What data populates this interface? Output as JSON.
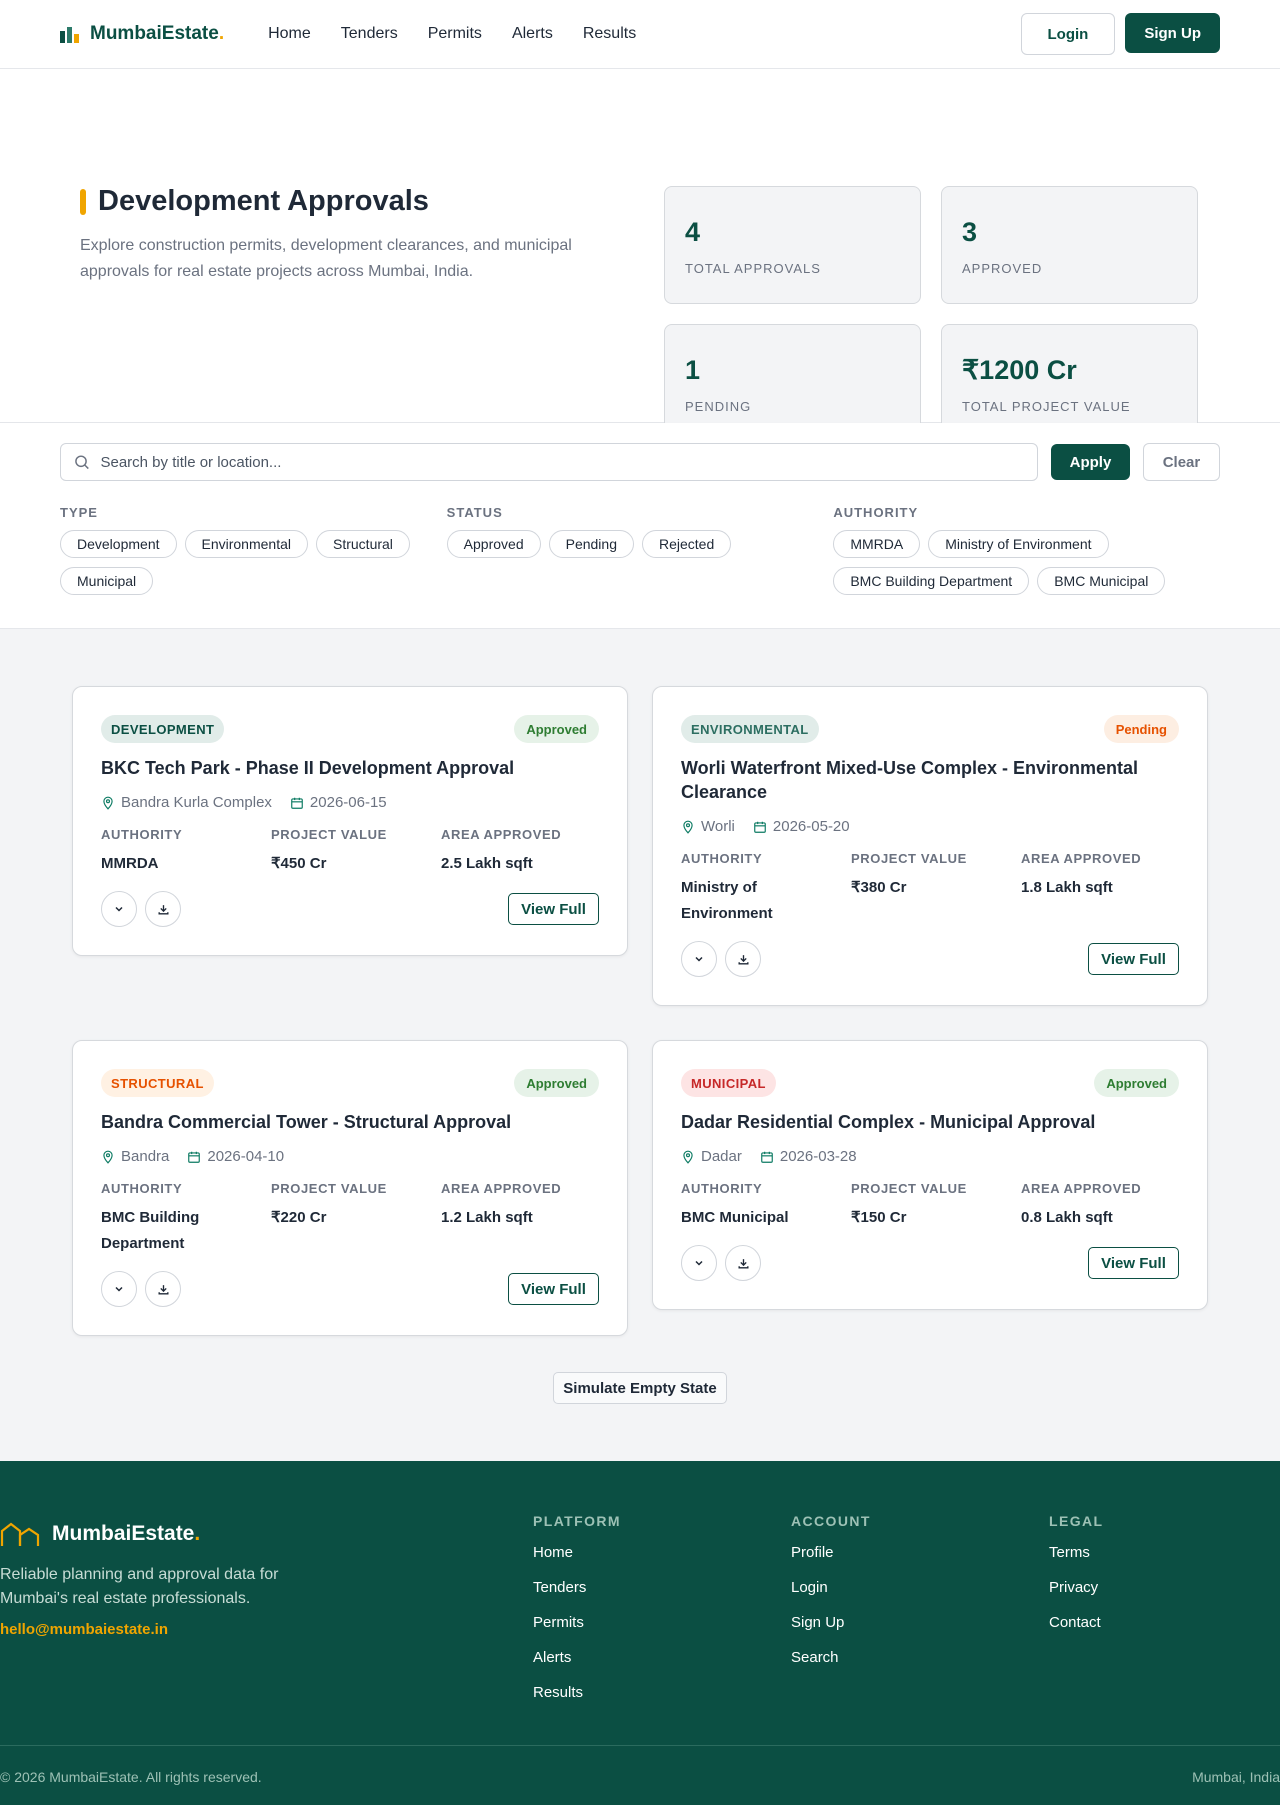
{
  "nav": {
    "brand": "MumbaiEstate",
    "brand_dot": ".",
    "links": [
      "Home",
      "Tenders",
      "Permits",
      "Alerts",
      "Results"
    ],
    "login": "Login",
    "signup": "Sign Up"
  },
  "hero": {
    "title": "Development Approvals",
    "description": "Explore construction permits, development clearances, and municipal approvals for real estate projects across Mumbai, India.",
    "stats": [
      {
        "value": "4",
        "label": "TOTAL APPROVALS"
      },
      {
        "value": "3",
        "label": "APPROVED"
      },
      {
        "value": "1",
        "label": "PENDING"
      },
      {
        "value": "₹1200 Cr",
        "label": "TOTAL PROJECT VALUE"
      }
    ]
  },
  "filters": {
    "search_placeholder": "Search by title or location...",
    "apply": "Apply",
    "clear": "Clear",
    "groups": [
      {
        "label": "TYPE",
        "options": [
          "Development",
          "Environmental",
          "Structural",
          "Municipal"
        ]
      },
      {
        "label": "STATUS",
        "options": [
          "Approved",
          "Pending",
          "Rejected"
        ]
      },
      {
        "label": "AUTHORITY",
        "options": [
          "MMRDA",
          "Ministry of Environment",
          "BMC Building Department",
          "BMC Municipal"
        ]
      }
    ]
  },
  "labels": {
    "authority": "AUTHORITY",
    "project_value": "PROJECT VALUE",
    "area_approved": "AREA APPROVED",
    "view_full": "View Full"
  },
  "colors": {
    "brand": "#0b4f43",
    "accent": "#f0a500",
    "approved_bg": "#e6f2e8",
    "approved_fg": "#2e7d32",
    "pending_bg": "#fdeee2",
    "pending_fg": "#e65100"
  },
  "cards": [
    {
      "type": "DEVELOPMENT",
      "type_bg": "#e1ece9",
      "type_fg": "#0b4f43",
      "status": "Approved",
      "status_kind": "approved",
      "title": "BKC Tech Park - Phase II Development Approval",
      "location": "Bandra Kurla Complex",
      "date": "2026-06-15",
      "authority": "MMRDA",
      "value": "₹450 Cr",
      "area": "2.5 Lakh sqft"
    },
    {
      "type": "ENVIRONMENTAL",
      "type_bg": "#e1ece9",
      "type_fg": "#2c6e61",
      "status": "Pending",
      "status_kind": "pending",
      "title": "Worli Waterfront Mixed-Use Complex - Environmental Clearance",
      "location": "Worli",
      "date": "2026-05-20",
      "authority": "Ministry of Environment",
      "value": "₹380 Cr",
      "area": "1.8 Lakh sqft"
    },
    {
      "type": "STRUCTURAL",
      "type_bg": "#fff1e3",
      "type_fg": "#e65100",
      "status": "Approved",
      "status_kind": "approved",
      "title": "Bandra Commercial Tower - Structural Approval",
      "location": "Bandra",
      "date": "2026-04-10",
      "authority": "BMC Building Department",
      "value": "₹220 Cr",
      "area": "1.2 Lakh sqft"
    },
    {
      "type": "MUNICIPAL",
      "type_bg": "#fde4e4",
      "type_fg": "#c62828",
      "status": "Approved",
      "status_kind": "approved",
      "title": "Dadar Residential Complex - Municipal Approval",
      "location": "Dadar",
      "date": "2026-03-28",
      "authority": "BMC Municipal",
      "value": "₹150 Cr",
      "area": "0.8 Lakh sqft"
    }
  ],
  "simulate_button": "Simulate Empty State",
  "footer": {
    "brand": "MumbaiEstate",
    "brand_dot": ".",
    "description": "Reliable planning and approval data for Mumbai's real estate professionals.",
    "email": "hello@mumbaiestate.in",
    "columns": [
      {
        "title": "PLATFORM",
        "links": [
          "Home",
          "Tenders",
          "Permits",
          "Alerts",
          "Results"
        ]
      },
      {
        "title": "ACCOUNT",
        "links": [
          "Profile",
          "Login",
          "Sign Up",
          "Search"
        ]
      },
      {
        "title": "LEGAL",
        "links": [
          "Terms",
          "Privacy",
          "Contact"
        ]
      }
    ],
    "copyright": "© 2026 MumbaiEstate. All rights reserved.",
    "location": "Mumbai, India"
  }
}
